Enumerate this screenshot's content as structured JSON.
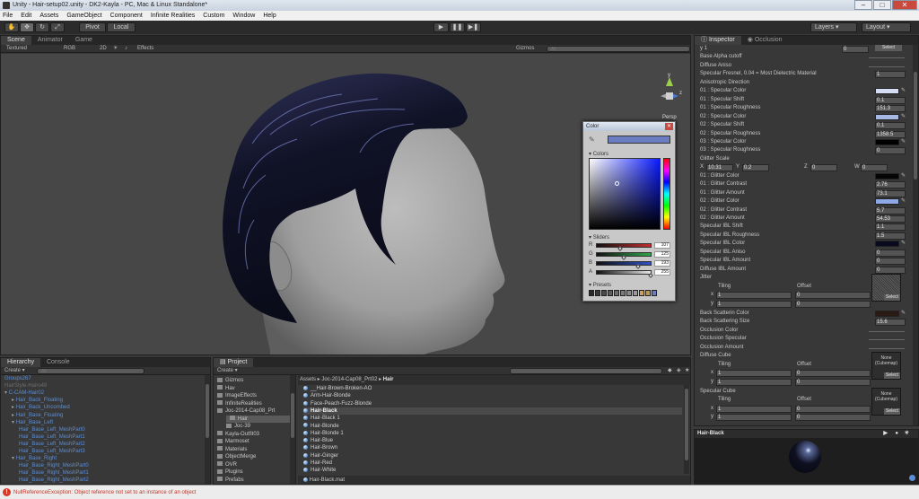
{
  "window": {
    "title": "Unity - Hair-setup02.unity - DK2-Kayla - PC, Mac & Linux Standalone*"
  },
  "menu": [
    "File",
    "Edit",
    "Assets",
    "GameObject",
    "Component",
    "Infinite Realities",
    "Custom",
    "Window",
    "Help"
  ],
  "toolbar": {
    "pivot": "Pivot",
    "local": "Local",
    "layers": "Layers",
    "layout": "Layout"
  },
  "scene": {
    "tabs": [
      "Scene",
      "Animator",
      "Game"
    ],
    "shading": "Textured",
    "render": "RGB",
    "mode_2d": "2D",
    "effects": "Effects",
    "gizmos": "Gizmos",
    "search_placeholder": "All",
    "gizmo_label": "Persp",
    "gizmo_axes": {
      "y": "y",
      "z": "z"
    }
  },
  "color_window": {
    "title": "Color",
    "colors_label": "Colors",
    "sliders_label": "Sliders",
    "presets_label": "Presets",
    "sliders": [
      {
        "name": "R",
        "value": "107",
        "color": "#c42e2e",
        "fraction": 0.42
      },
      {
        "name": "G",
        "value": "125",
        "color": "#2ea64a",
        "fraction": 0.49
      },
      {
        "name": "B",
        "value": "193",
        "color": "#2e4fc4",
        "fraction": 0.76
      },
      {
        "name": "A",
        "value": "255",
        "color": "#e6e6e6",
        "fraction": 1.0
      }
    ],
    "selected_color": "#6b7dc1",
    "presets": [
      "#2b2b2b",
      "#3a3a3a",
      "#4a4a4a",
      "#5a5a5a",
      "#6b6b6b",
      "#7a7a7a",
      "#8a8a8a",
      "#9a9a9a",
      "#c8a25a",
      "#b89a60",
      "#6b7dc1"
    ]
  },
  "inspector": {
    "tabs": [
      "Inspector",
      "Occlusion"
    ],
    "select_label": "Select",
    "rows": [
      {
        "label": "y 1",
        "value": "0",
        "kind": "tiling"
      },
      {
        "label": "Base Alpha cutoff",
        "kind": "slider"
      },
      {
        "label": "Diffuse Aniso",
        "kind": "slider"
      },
      {
        "label": "Specular Fresnel, 0.04 = Most Dielectric Material",
        "value": "1",
        "kind": "value"
      },
      {
        "label": "Anisotropic Direction",
        "kind": "header"
      },
      {
        "label": "01 : Specular Color",
        "kind": "color",
        "color": "#d6dcf2"
      },
      {
        "label": "01 : Specular Shift",
        "value": "0.1",
        "kind": "value"
      },
      {
        "label": "01 : Specular Roughness",
        "value": "151.3",
        "kind": "value"
      },
      {
        "label": "02 : Specular Color",
        "kind": "color",
        "color": "#a8b8e4"
      },
      {
        "label": "02 : Specular Shift",
        "value": "0.1",
        "kind": "value"
      },
      {
        "label": "02 : Specular Roughness",
        "value": "1358.5",
        "kind": "value"
      },
      {
        "label": "03 : Specular Color",
        "kind": "color",
        "color": "#000000"
      },
      {
        "label": "03 : Specular Roughness",
        "value": "0",
        "kind": "value"
      },
      {
        "label": "Glitter Scale",
        "kind": "header"
      },
      {
        "label": "",
        "kind": "vector",
        "x": "10.31",
        "y": "0.2",
        "z": "0",
        "w": "0"
      },
      {
        "label": "01 : Glitter Color",
        "kind": "color",
        "color": "#050505"
      },
      {
        "label": "01 : Glitter Contrast",
        "value": "2.76",
        "kind": "value"
      },
      {
        "label": "01 : Glitter Amount",
        "value": "73.1",
        "kind": "value"
      },
      {
        "label": "02 : Glitter Color",
        "kind": "color",
        "color": "#8fa8e6"
      },
      {
        "label": "02 : Glitter Contrast",
        "value": "5.7",
        "kind": "value"
      },
      {
        "label": "02 : Glitter Amount",
        "value": "54.53",
        "kind": "value"
      },
      {
        "label": "Specular IBL Shift",
        "value": "1.1",
        "kind": "value"
      },
      {
        "label": "Specular IBL Roughness",
        "value": "1.5",
        "kind": "value"
      },
      {
        "label": "Specular IBL Color",
        "kind": "color",
        "color": "#0a0a1e"
      },
      {
        "label": "Specular IBL Aniso",
        "value": "0",
        "kind": "value"
      },
      {
        "label": "Specular IBL Amount",
        "value": "0",
        "kind": "value"
      },
      {
        "label": "Diffuse IBL Amount",
        "value": "0",
        "kind": "value"
      }
    ],
    "jitter": {
      "label": "Jitter",
      "tiling": "Tiling",
      "offset": "Offset",
      "x1": "1",
      "x1_off": "0",
      "y1": "1",
      "y1_off": "0"
    },
    "rows2": [
      {
        "label": "Back Scatterin Color",
        "kind": "color",
        "color": "#2a1a16"
      },
      {
        "label": "Back Scattering Size",
        "value": "15.6",
        "kind": "value"
      },
      {
        "label": "Occlusion Color",
        "kind": "slider"
      },
      {
        "label": "Occlusion Specular",
        "kind": "slider"
      },
      {
        "label": "Occlusion Amount",
        "kind": "slider"
      }
    ],
    "diffuse_cube": {
      "label": "Diffuse Cube",
      "tiling": "Tiling",
      "offset": "Offset",
      "x": "1",
      "x_off": "0",
      "y": "1",
      "y_off": "0",
      "slot": "None (Cubemap)"
    },
    "specular_cube": {
      "label": "Specular Cube",
      "tiling": "Tiling",
      "offset": "Offset",
      "x": "1",
      "x_off": "0",
      "y": "1",
      "y_off": "0",
      "slot": "None (Cubemap)"
    },
    "preview_title": "Hair-Black"
  },
  "hierarchy": {
    "tabs": [
      "Hierarchy",
      "Console"
    ],
    "create": "Create",
    "search_placeholder": "All",
    "items": [
      {
        "label": "Groups267",
        "depth": 0,
        "color": "#5b8ed6"
      },
      {
        "label": "HairStyle-Hairo49",
        "depth": 0,
        "color": "#6d6d6d"
      },
      {
        "label": "C-CAM-Hair02",
        "depth": 0,
        "color": "#5b8ed6"
      },
      {
        "label": "Hair_Back_Floating",
        "depth": 1,
        "color": "#5b8ed6"
      },
      {
        "label": "Hair_Back_Uncombed",
        "depth": 1,
        "color": "#5b8ed6"
      },
      {
        "label": "Hair_Base_Floating",
        "depth": 1,
        "color": "#5b8ed6"
      },
      {
        "label": "Hair_Base_Left",
        "depth": 1,
        "color": "#5b8ed6"
      },
      {
        "label": "Hair_Base_Left_MeshPart0",
        "depth": 2,
        "color": "#5b8ed6"
      },
      {
        "label": "Hair_Base_Left_MeshPart1",
        "depth": 2,
        "color": "#5b8ed6"
      },
      {
        "label": "Hair_Base_Left_MeshPart2",
        "depth": 2,
        "color": "#5b8ed6"
      },
      {
        "label": "Hair_Base_Left_MeshPart3",
        "depth": 2,
        "color": "#5b8ed6"
      },
      {
        "label": "Hair_Base_Right",
        "depth": 1,
        "color": "#5b8ed6"
      },
      {
        "label": "Hair_Base_Right_MeshPart0",
        "depth": 2,
        "color": "#5b8ed6"
      },
      {
        "label": "Hair_Base_Right_MeshPart1",
        "depth": 2,
        "color": "#5b8ed6"
      },
      {
        "label": "Hair_Base_Right_MeshPart2",
        "depth": 2,
        "color": "#5b8ed6"
      }
    ]
  },
  "project": {
    "tab": "Project",
    "create": "Create",
    "folders": [
      {
        "label": "Gizmos",
        "depth": 0
      },
      {
        "label": "Hav",
        "depth": 0
      },
      {
        "label": "ImageEffects",
        "depth": 0
      },
      {
        "label": "InfiniteRealities",
        "depth": 0
      },
      {
        "label": "Joc-2014-Cap08_Prt",
        "depth": 0
      },
      {
        "label": "Hair",
        "depth": 1
      },
      {
        "label": "Joc-39",
        "depth": 1
      },
      {
        "label": "Kayla-Outfit03",
        "depth": 0
      },
      {
        "label": "Marmoset",
        "depth": 0
      },
      {
        "label": "Materials",
        "depth": 0
      },
      {
        "label": "ObjectMerge",
        "depth": 0
      },
      {
        "label": "OVR",
        "depth": 0
      },
      {
        "label": "Plugins",
        "depth": 0
      },
      {
        "label": "Prefabs",
        "depth": 0
      }
    ],
    "breadcrumb": [
      "Assets",
      "Joc-2014-Cap08_Prt02",
      "Hair"
    ],
    "assets": [
      "__Hair-Brown-Broken-AO",
      "Arm-Hair-Blonde",
      "Face-Peach-Fuzz-Blonde",
      "Hair-Black",
      "Hair-Black 1",
      "Hair-Blonde",
      "Hair-Blonde 1",
      "Hair-Blue",
      "Hair-Brown",
      "Hair-Ginger",
      "Hair-Red",
      "Hair-White"
    ],
    "selected_asset": "Hair-Black",
    "footer": "Hair-Black.mat"
  },
  "status": {
    "message": "NullReferenceException: Object reference not set to an instance of an object"
  }
}
